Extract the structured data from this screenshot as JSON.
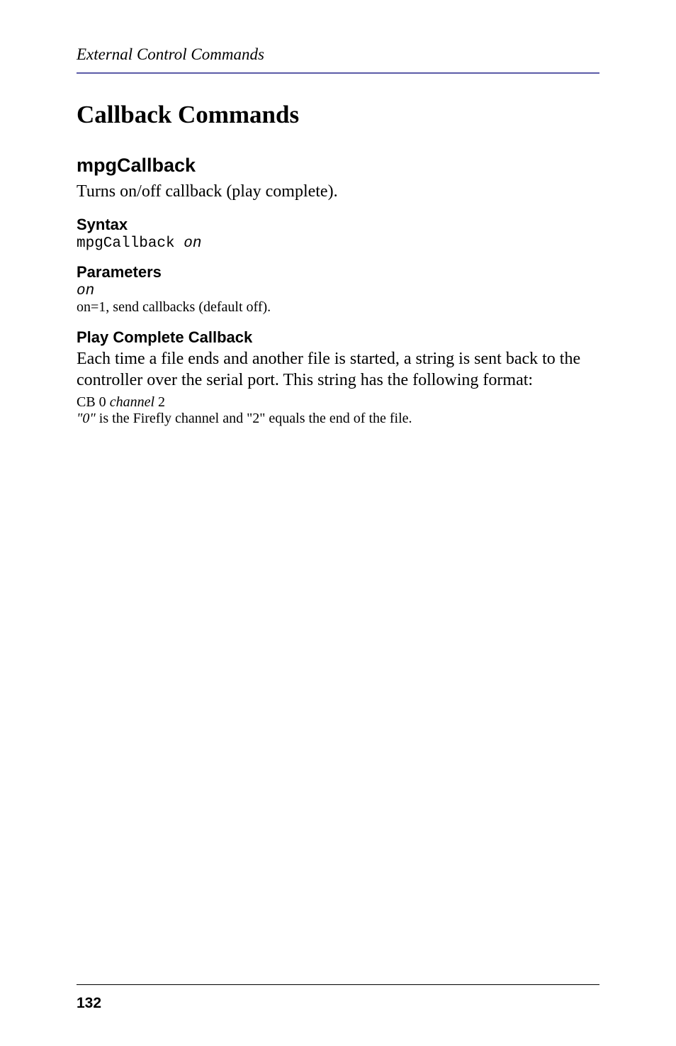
{
  "header": {
    "running": "External Control Commands"
  },
  "section": {
    "title": "Callback Commands"
  },
  "command": {
    "name": "mpgCallback",
    "description": "Turns on/off callback (play complete).",
    "syntax_label": "Syntax",
    "syntax_cmd": "mpgCallback ",
    "syntax_arg": "on",
    "parameters_label": "Parameters",
    "param_name": "on",
    "param_desc": "on=1, send callbacks (default off).",
    "play_complete_label": "Play Complete Callback",
    "play_complete_body": "Each time a file ends and another file is started, a string is sent back to the controller over the serial port. This string has the following format:",
    "cb_prefix": "CB 0 ",
    "cb_channel": "channel",
    "cb_suffix": " 2",
    "cb_note_leading": " ",
    "cb_note_zero": "\"0\"",
    "cb_note_rest": " is the Firefly channel and \"2\" equals the end of the file."
  },
  "footer": {
    "page": "132"
  }
}
